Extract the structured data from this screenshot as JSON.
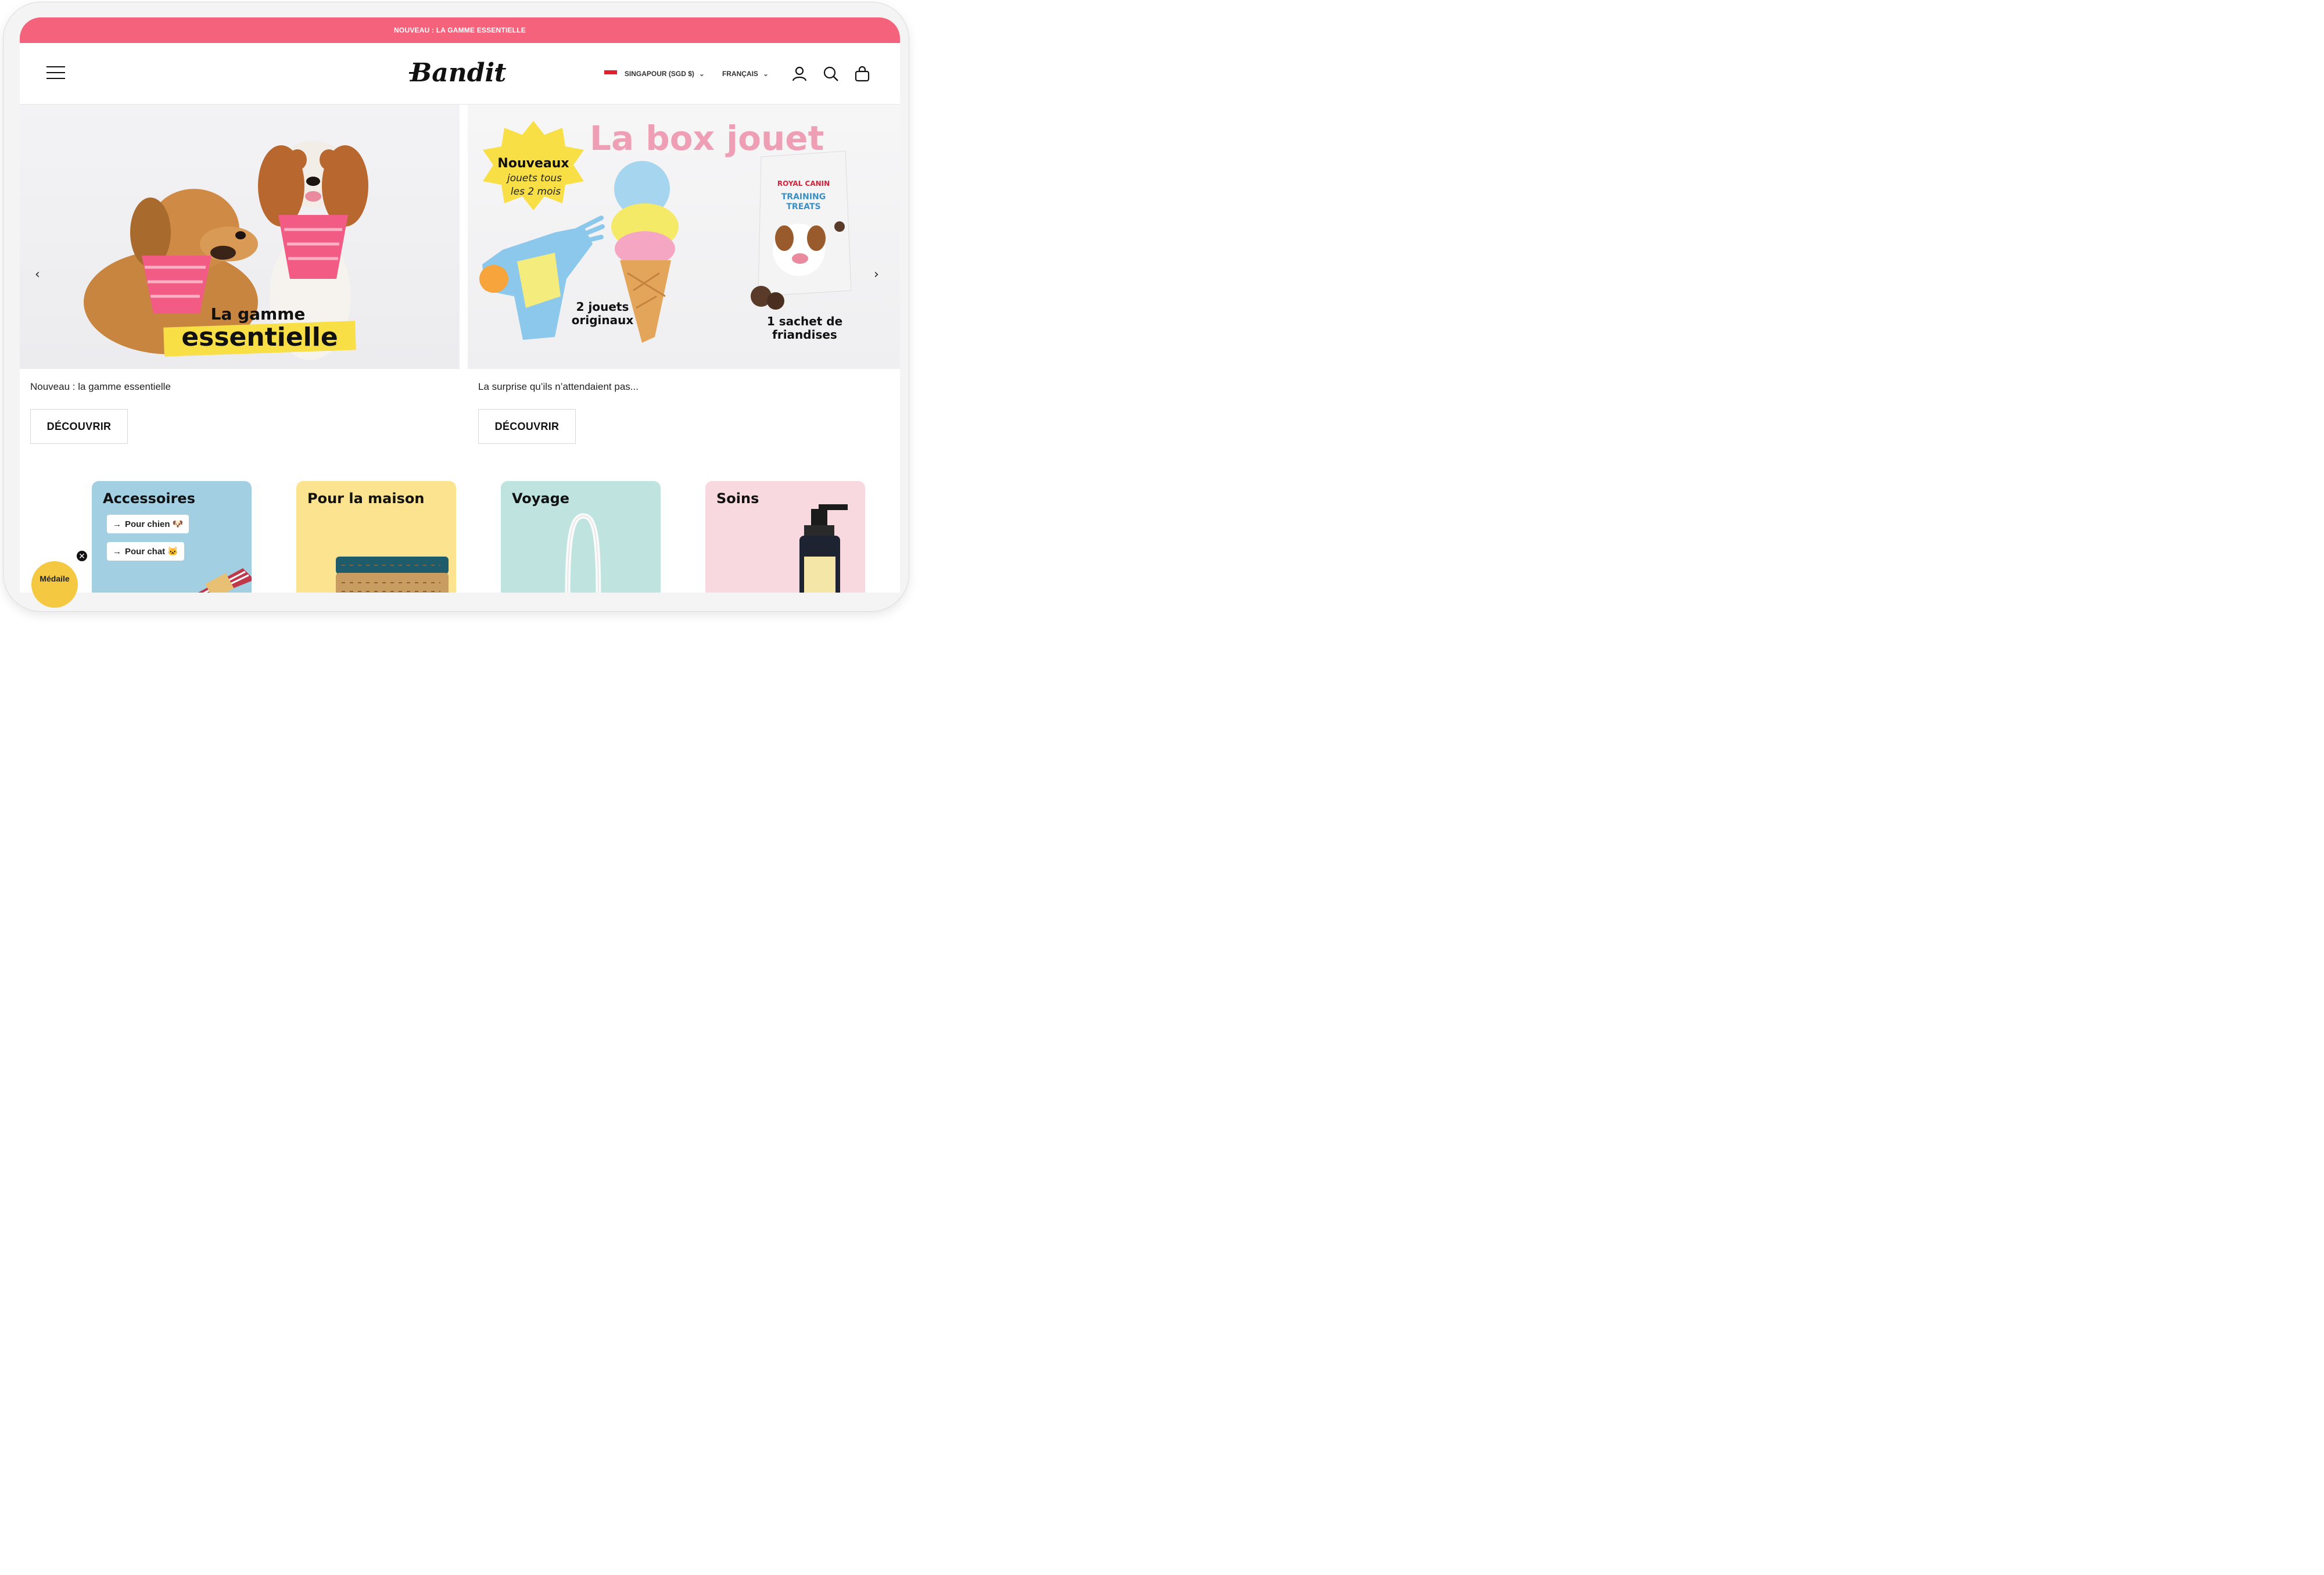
{
  "announcement": {
    "text": "NOUVEAU : LA GAMME ESSENTIELLE"
  },
  "header": {
    "logo": "Bandit",
    "country": "SINGAPOUR (SGD $)",
    "language": "FRANÇAIS",
    "icons": [
      "menu-icon",
      "user-icon",
      "search-icon",
      "bag-icon"
    ]
  },
  "hero": {
    "left": {
      "overlay_line1": "La gamme",
      "overlay_line2": "essentielle",
      "caption": "Nouveau : la gamme essentielle",
      "button": "DÉCOUVRIR"
    },
    "right": {
      "title": "La box jouet",
      "badge_line1": "Nouveaux",
      "badge_line2": "jouets tous",
      "badge_line3": "les 2 mois",
      "toys_label_1": "2 jouets",
      "toys_label_2": "originaux",
      "treats_label_1": "1 sachet de",
      "treats_label_2": "friandises",
      "pack_brand": "ROYAL CANIN",
      "pack_line1": "TRAINING",
      "pack_line2": "TREATS",
      "caption": "La surprise qu’ils n’attendaient pas...",
      "button": "DÉCOUVRIR"
    },
    "prev_arrow": "‹",
    "next_arrow": "›"
  },
  "categories": [
    {
      "title": "Accessoires",
      "color": "#a3cfe2"
    },
    {
      "title": "Pour la maison",
      "color": "#fbe38f"
    },
    {
      "title": "Voyage",
      "color": "#bfe3df"
    },
    {
      "title": "Soins",
      "color": "#f9d9e0"
    }
  ],
  "accessoires_links": [
    "Pour chien 🐶",
    "Pour chat 🐱"
  ],
  "medal": {
    "label": "Médaile"
  },
  "colors": {
    "announcement": "#f4627c",
    "pink_title": "#ef9fb5",
    "yellow": "#f8df45"
  }
}
